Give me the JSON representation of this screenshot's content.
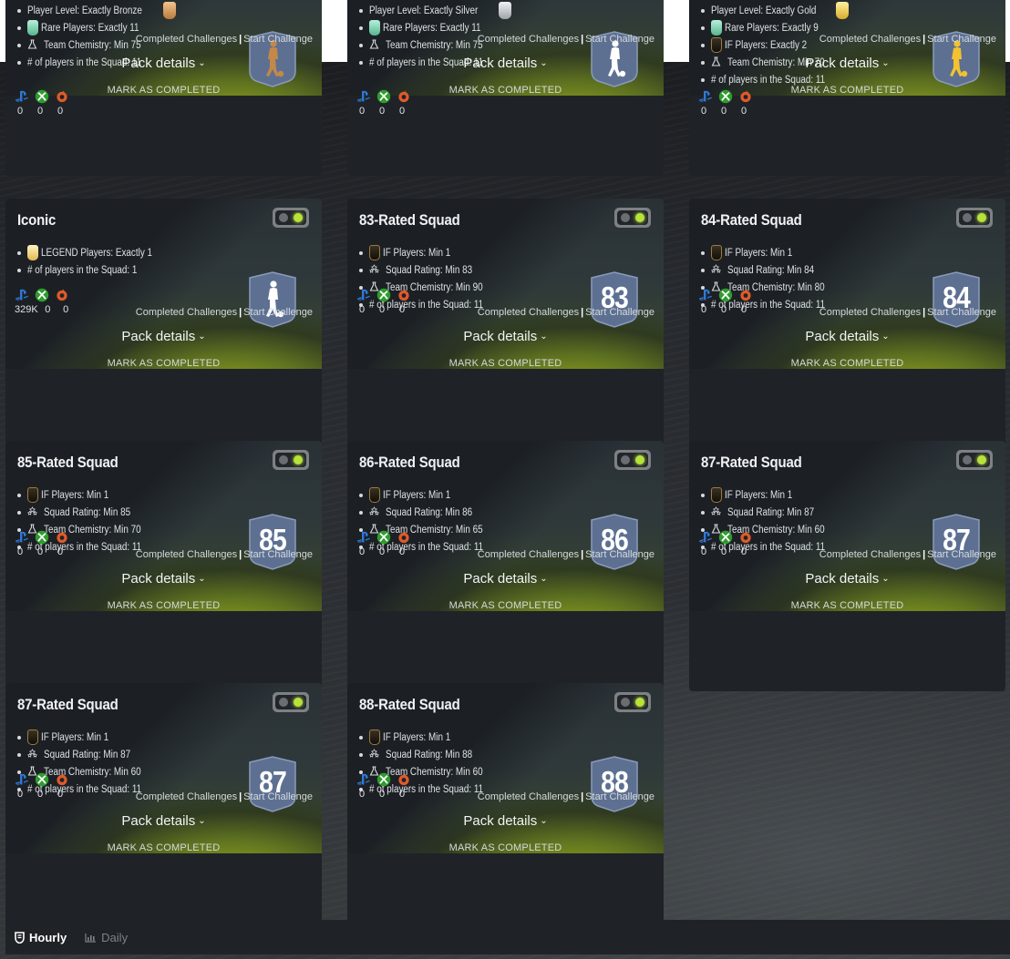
{
  "labels": {
    "completed": "Completed Challenges",
    "start": "Start Challenge",
    "pack_details": "Pack details",
    "mark_completed": "MARK AS COMPLETED"
  },
  "cards": [
    {
      "title": "",
      "reqs": [
        {
          "text": "Player Level: Exactly Bronze",
          "icon": "bronze-card-icon",
          "icon_after": true
        },
        {
          "text": "Rare Players: Exactly 11",
          "icon": "rare-card-icon"
        },
        {
          "text": "Team Chemistry: Min 75",
          "icon": "flask-icon"
        },
        {
          "text": "# of players in the Squad: 11",
          "icon": ""
        }
      ],
      "badge": {
        "type": "player",
        "color": "#c48848"
      },
      "platform_values": [
        "0",
        "0",
        "0"
      ]
    },
    {
      "title": "",
      "reqs": [
        {
          "text": "Player Level: Exactly Silver",
          "icon": "silver-card-icon",
          "icon_after": true
        },
        {
          "text": "Rare Players: Exactly 11",
          "icon": "rare-card-icon"
        },
        {
          "text": "Team Chemistry: Min 75",
          "icon": "flask-icon"
        },
        {
          "text": "# of players in the Squad: 11",
          "icon": ""
        }
      ],
      "badge": {
        "type": "player",
        "color": "#ffffff"
      },
      "platform_values": [
        "0",
        "0",
        "0"
      ]
    },
    {
      "title": "",
      "reqs": [
        {
          "text": "Player Level: Exactly Gold",
          "icon": "gold-card-icon",
          "icon_after": true
        },
        {
          "text": "Rare Players: Exactly 9",
          "icon": "rare-card-icon"
        },
        {
          "text": "IF Players: Exactly 2",
          "icon": "if-card-icon"
        },
        {
          "text": "Team Chemistry: Min 70",
          "icon": "flask-icon"
        },
        {
          "text": "# of players in the Squad: 11",
          "icon": ""
        }
      ],
      "badge": {
        "type": "player",
        "color": "#f2c230"
      },
      "platform_values": [
        "0",
        "0",
        "0"
      ]
    },
    {
      "title": "Iconic",
      "reqs": [
        {
          "text": "LEGEND Players: Exactly 1",
          "icon": "legend-card-icon"
        },
        {
          "text": "# of players in the Squad: 1",
          "icon": ""
        }
      ],
      "badge": {
        "type": "player",
        "color": "#ffffff"
      },
      "platform_values": [
        "329K",
        "0",
        "0"
      ]
    },
    {
      "title": "83-Rated Squad",
      "reqs": [
        {
          "text": "IF Players: Min 1",
          "icon": "if-card-icon"
        },
        {
          "text": "Squad Rating: Min 83",
          "icon": "rating-stars-icon"
        },
        {
          "text": "Team Chemistry: Min 90",
          "icon": "flask-icon"
        },
        {
          "text": "# of players in the Squad: 11",
          "icon": ""
        }
      ],
      "badge": {
        "type": "number",
        "value": "83"
      },
      "platform_values": [
        "0",
        "0",
        "0"
      ]
    },
    {
      "title": "84-Rated Squad",
      "reqs": [
        {
          "text": "IF Players: Min 1",
          "icon": "if-card-icon"
        },
        {
          "text": "Squad Rating: Min 84",
          "icon": "rating-stars-icon"
        },
        {
          "text": "Team Chemistry: Min 80",
          "icon": "flask-icon"
        },
        {
          "text": "# of players in the Squad: 11",
          "icon": ""
        }
      ],
      "badge": {
        "type": "number",
        "value": "84"
      },
      "platform_values": [
        "0",
        "0",
        "0"
      ]
    },
    {
      "title": "85-Rated Squad",
      "reqs": [
        {
          "text": "IF Players: Min 1",
          "icon": "if-card-icon"
        },
        {
          "text": "Squad Rating: Min 85",
          "icon": "rating-stars-icon"
        },
        {
          "text": "Team Chemistry: Min 70",
          "icon": "flask-icon"
        },
        {
          "text": "# of players in the Squad: 11",
          "icon": ""
        }
      ],
      "badge": {
        "type": "number",
        "value": "85"
      },
      "platform_values": [
        "0",
        "0",
        "0"
      ]
    },
    {
      "title": "86-Rated Squad",
      "reqs": [
        {
          "text": "IF Players: Min 1",
          "icon": "if-card-icon"
        },
        {
          "text": "Squad Rating: Min 86",
          "icon": "rating-stars-icon"
        },
        {
          "text": "Team Chemistry: Min 65",
          "icon": "flask-icon"
        },
        {
          "text": "# of players in the Squad: 11",
          "icon": ""
        }
      ],
      "badge": {
        "type": "number",
        "value": "86"
      },
      "platform_values": [
        "0",
        "0",
        "0"
      ]
    },
    {
      "title": "87-Rated Squad",
      "reqs": [
        {
          "text": "IF Players: Min 1",
          "icon": "if-card-icon"
        },
        {
          "text": "Squad Rating: Min 87",
          "icon": "rating-stars-icon"
        },
        {
          "text": "Team Chemistry: Min 60",
          "icon": "flask-icon"
        },
        {
          "text": "# of players in the Squad: 11",
          "icon": ""
        }
      ],
      "badge": {
        "type": "number",
        "value": "87"
      },
      "platform_values": [
        "0",
        "0",
        "0"
      ]
    },
    {
      "title": "87-Rated Squad",
      "reqs": [
        {
          "text": "IF Players: Min 1",
          "icon": "if-card-icon"
        },
        {
          "text": "Squad Rating: Min 87",
          "icon": "rating-stars-icon"
        },
        {
          "text": "Team Chemistry: Min 60",
          "icon": "flask-icon"
        },
        {
          "text": "# of players in the Squad: 11",
          "icon": ""
        }
      ],
      "badge": {
        "type": "number",
        "value": "87"
      },
      "platform_values": [
        "0",
        "0",
        "0"
      ]
    },
    {
      "title": "88-Rated Squad",
      "reqs": [
        {
          "text": "IF Players: Min 1",
          "icon": "if-card-icon"
        },
        {
          "text": "Squad Rating: Min 88",
          "icon": "rating-stars-icon"
        },
        {
          "text": "Team Chemistry: Min 60",
          "icon": "flask-icon"
        },
        {
          "text": "# of players in the Squad: 11",
          "icon": ""
        }
      ],
      "badge": {
        "type": "number",
        "value": "88"
      },
      "platform_values": [
        "0",
        "0",
        "0"
      ]
    }
  ],
  "footer": {
    "tabs": [
      {
        "label": "Hourly",
        "icon": "hourly-icon",
        "active": true
      },
      {
        "label": "Daily",
        "icon": "chart-icon",
        "active": false
      }
    ]
  }
}
